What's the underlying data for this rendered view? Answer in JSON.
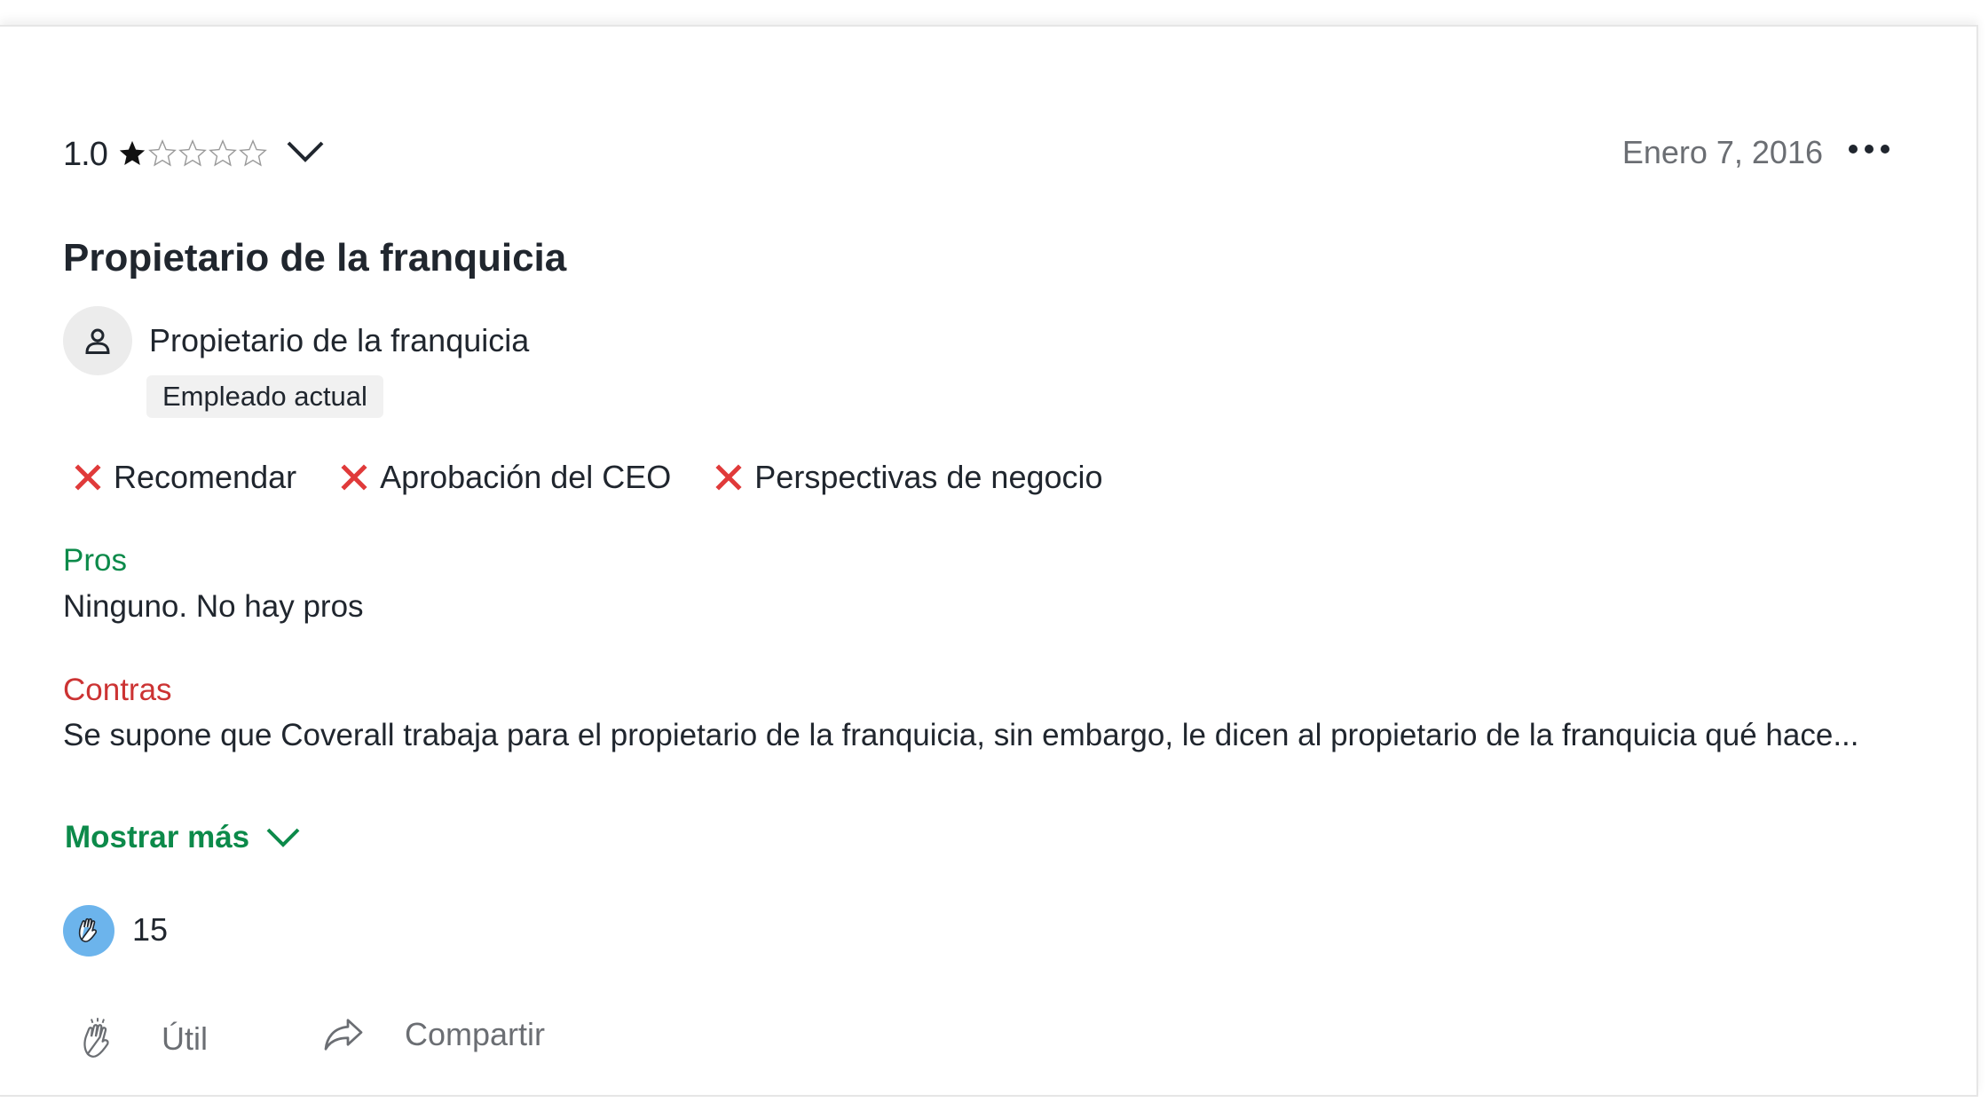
{
  "review": {
    "rating": {
      "value_text": "1.0",
      "stars_filled": 1,
      "stars_total": 5
    },
    "date": "Enero 7, 2016",
    "title": "Propietario de la franquicia",
    "author": {
      "role": "Propietario de la franquicia",
      "status_badge": "Empleado actual"
    },
    "indicators": [
      {
        "label": "Recomendar",
        "status": "negative",
        "icon": "x-icon"
      },
      {
        "label": "Aprobación del CEO",
        "status": "negative",
        "icon": "x-icon"
      },
      {
        "label": "Perspectivas de negocio",
        "status": "negative",
        "icon": "x-icon"
      }
    ],
    "pros": {
      "label": "Pros",
      "text": "Ninguno. No hay pros"
    },
    "cons": {
      "label": "Contras",
      "text": "Se supone que Coverall trabaja para el propietario de la franquicia, sin embargo, le dicen al propietario de la franquicia qué hace..."
    },
    "show_more_label": "Mostrar más",
    "helpful_count": "15",
    "actions": {
      "helpful_label": "Útil",
      "share_label": "Compartir"
    }
  },
  "colors": {
    "pros": "#0c8a4a",
    "cons": "#cc3333",
    "negative_icon": "#e03a3a",
    "helpful_badge": "#6cb4ec",
    "text": "#20262e",
    "muted": "#6b6e73"
  }
}
